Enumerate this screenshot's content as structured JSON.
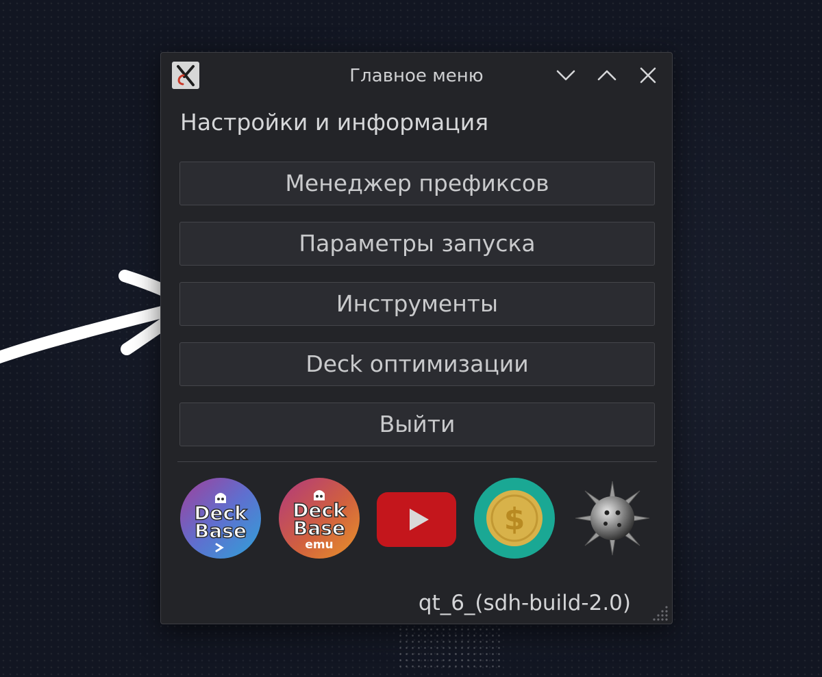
{
  "window": {
    "title": "Главное меню"
  },
  "main": {
    "heading": "Настройки и информация",
    "buttons": [
      {
        "label": "Менеджер префиксов"
      },
      {
        "label": "Параметры запуска"
      },
      {
        "label": "Инструменты"
      },
      {
        "label": "Deck оптимизации"
      },
      {
        "label": "Выйти"
      }
    ]
  },
  "links": [
    {
      "icon": "deckbase-logo-icon",
      "top": "Deck",
      "bottom": "Base"
    },
    {
      "icon": "deckbase-emu-logo-icon",
      "top": "Deck",
      "bottom": "Base",
      "sub": "emu"
    },
    {
      "icon": "youtube-icon"
    },
    {
      "icon": "donate-coin-icon",
      "symbol": "$"
    },
    {
      "icon": "spiked-mine-icon"
    }
  ],
  "footer": {
    "version": "qt_6_(sdh-build-2.0)"
  },
  "colors": {
    "window_bg": "#232428",
    "button_bg": "#2b2c31",
    "youtube_red": "#c4161c",
    "coin_teal": "#1aa894",
    "coin_gold": "#d8b24a"
  }
}
